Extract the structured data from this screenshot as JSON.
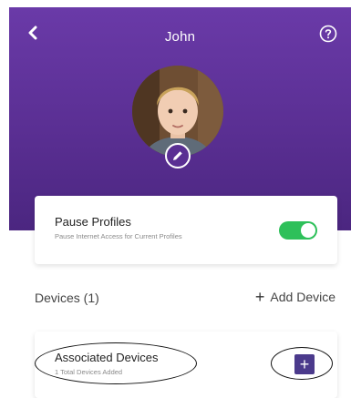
{
  "header": {
    "title": "John",
    "back_icon": "chevron-left-icon",
    "help_icon": "question-circle-icon",
    "background_color": "#5a2f93"
  },
  "avatar": {
    "edit_icon": "pencil-icon"
  },
  "pause_profiles": {
    "title": "Pause Profiles",
    "subtitle": "Pause Internet Access for Current Profiles",
    "toggle_on": true,
    "toggle_color": "#2ec05a"
  },
  "devices": {
    "heading": "Devices (1)",
    "add_label": "Add Device",
    "add_icon": "plus-icon"
  },
  "associated_devices": {
    "title": "Associated Devices",
    "subtitle": "1 Total Devices Added",
    "add_icon": "plus-icon",
    "button_color": "#4b3a8c"
  }
}
